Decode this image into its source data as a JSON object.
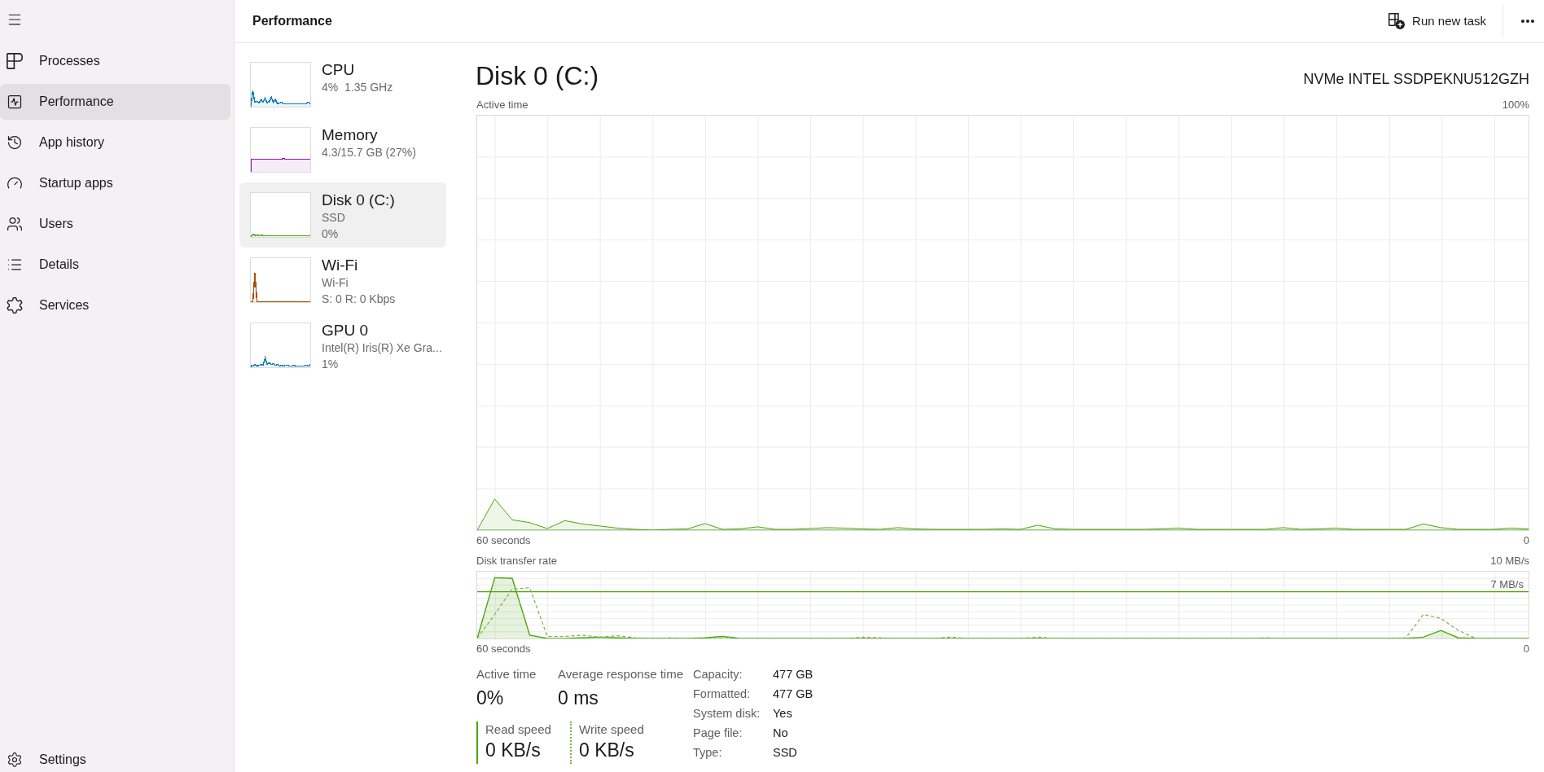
{
  "sidebar": {
    "items": [
      {
        "label": "Processes",
        "selected": false
      },
      {
        "label": "Performance",
        "selected": true
      },
      {
        "label": "App history",
        "selected": false
      },
      {
        "label": "Startup apps",
        "selected": false
      },
      {
        "label": "Users",
        "selected": false
      },
      {
        "label": "Details",
        "selected": false
      },
      {
        "label": "Services",
        "selected": false
      }
    ],
    "settings": {
      "label": "Settings"
    }
  },
  "header": {
    "title": "Performance",
    "run_task": "Run new task"
  },
  "perf_items": [
    {
      "name": "CPU",
      "lines": [
        "4%  1.35 GHz"
      ],
      "color": "#117dbb",
      "selected": false
    },
    {
      "name": "Memory",
      "lines": [
        "4.3/15.7 GB (27%)"
      ],
      "color": "#8b12ae",
      "selected": false
    },
    {
      "name": "Disk 0 (C:)",
      "lines": [
        "SSD",
        "0%"
      ],
      "color": "#4da60c",
      "selected": true
    },
    {
      "name": "Wi-Fi",
      "lines": [
        "Wi-Fi",
        "S: 0 R: 0 Kbps"
      ],
      "color": "#a74f01",
      "selected": false
    },
    {
      "name": "GPU 0",
      "lines": [
        "Intel(R) Iris(R) Xe Gra...",
        "1%"
      ],
      "color": "#117dbb",
      "selected": false
    }
  ],
  "detail": {
    "title": "Disk 0 (C:)",
    "model": "NVMe INTEL SSDPEKNU512GZH",
    "active_chart": {
      "title": "Active time",
      "top_label": "100%",
      "span_label": "60 seconds",
      "bottom_label": "0"
    },
    "transfer_chart": {
      "title": "Disk transfer rate",
      "top_label": "10 MB/s",
      "line_label": "7 MB/s",
      "span_label": "60 seconds",
      "bottom_label": "0"
    },
    "metrics": [
      {
        "label": "Active time",
        "value": "0%"
      },
      {
        "label": "Average response time",
        "value": "0 ms"
      }
    ],
    "speeds": [
      {
        "kind": "solid",
        "label": "Read speed",
        "value": "0 KB/s"
      },
      {
        "kind": "dotted",
        "label": "Write speed",
        "value": "0 KB/s"
      }
    ],
    "properties": [
      {
        "label": "Capacity:",
        "value": "477 GB"
      },
      {
        "label": "Formatted:",
        "value": "477 GB"
      },
      {
        "label": "System disk:",
        "value": "Yes"
      },
      {
        "label": "Page file:",
        "value": "No"
      },
      {
        "label": "Type:",
        "value": "SSD"
      }
    ]
  }
}
